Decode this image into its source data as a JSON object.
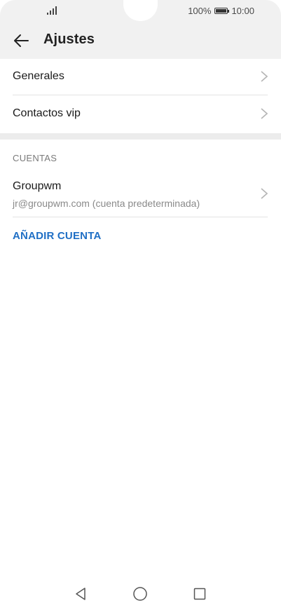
{
  "status_bar": {
    "battery_percent_text": "100%",
    "time": "10:00"
  },
  "header": {
    "title": "Ajustes",
    "back_icon": "arrow-left-icon"
  },
  "settings": {
    "items": [
      {
        "label": "Generales",
        "icon": "chevron-right-icon"
      },
      {
        "label": "Contactos vip",
        "icon": "chevron-right-icon"
      }
    ]
  },
  "accounts": {
    "section_title": "CUENTAS",
    "items": [
      {
        "name": "Groupwm",
        "email": "jr@groupwm.com (cuenta predeterminada)",
        "icon": "chevron-right-icon"
      }
    ],
    "add_label": "AÑADIR CUENTA"
  },
  "nav_bar": {
    "icons": [
      "back-triangle-icon",
      "home-circle-icon",
      "recents-square-icon"
    ]
  },
  "colors": {
    "accent": "#1f6fc5",
    "header_bg": "#f1f1f1",
    "section_gap": "#ececec"
  }
}
